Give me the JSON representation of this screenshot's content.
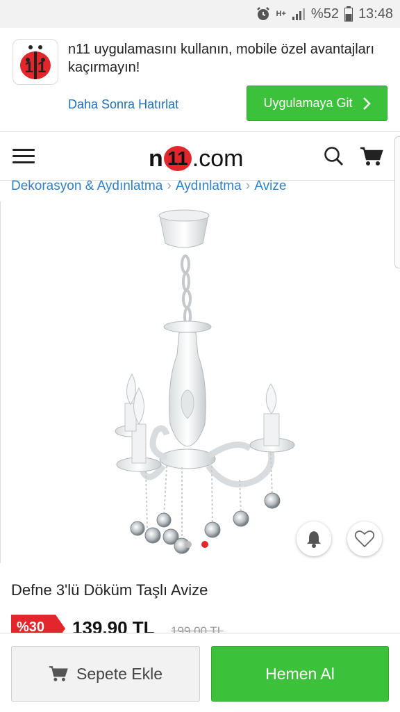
{
  "status_bar": {
    "network": "H+",
    "battery": "%52",
    "time": "13:48",
    "icons": [
      "alarm-icon",
      "network-type-icon",
      "signal-icon",
      "battery-icon"
    ]
  },
  "app_banner": {
    "message": "n11 uygulamasını kullanın, mobile özel avantajları kaçırmayın!",
    "remind_later": "Daha Sonra Hatırlat",
    "go_app_label": "Uygulamaya Git",
    "logo_text": "11"
  },
  "header": {
    "logo_n": "n",
    "logo_11": "11",
    "logo_suffix": ".com",
    "icons": [
      "menu-icon",
      "search-icon",
      "cart-icon"
    ]
  },
  "breadcrumb": {
    "items": [
      "Dekorasyon & Aydınlatma",
      "Aydınlatma",
      "Avize"
    ]
  },
  "product": {
    "title": "Defne 3'lü Döküm Taşlı Avize",
    "discount": "%30",
    "price": "139,90 TL",
    "old_price": "199,00 TL",
    "image_count": 2,
    "active_image": 2
  },
  "bottom_bar": {
    "add_to_cart": "Sepete Ekle",
    "buy_now": "Hemen Al"
  },
  "colors": {
    "brand_red": "#e3262b",
    "accent_green": "#3cc23a",
    "link_blue": "#2f80c8"
  }
}
